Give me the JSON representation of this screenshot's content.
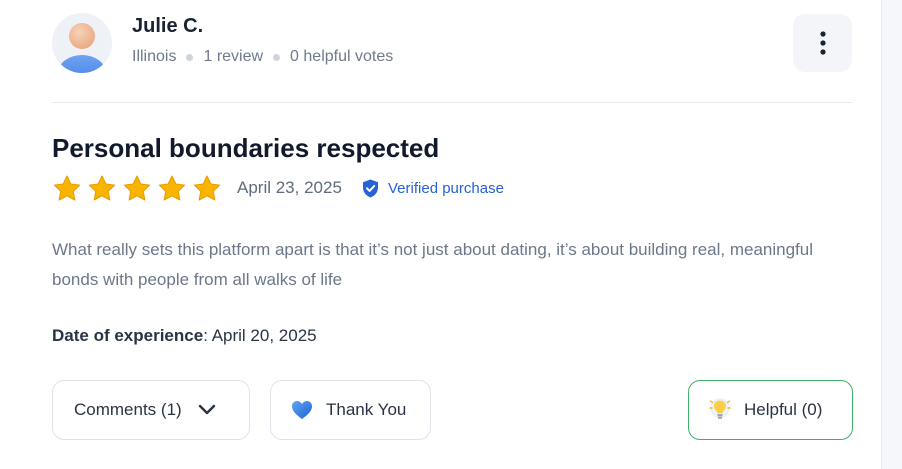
{
  "reviewer": {
    "name": "Julie C.",
    "location": "Illinois",
    "reviews": "1 review",
    "helpful_votes": "0 helpful votes"
  },
  "review": {
    "title": "Personal boundaries respected",
    "rating": 5,
    "rating_max": 5,
    "date": "April 23, 2025",
    "verified_label": "Verified purchase",
    "body": "What really sets this platform apart is that it’s not just about dating, it’s about building real, meaningful bonds with people from all walks of life",
    "experience_label": "Date of experience",
    "experience_date": "April 20, 2025"
  },
  "actions": {
    "comments_label": "Comments (1)",
    "thanks_label": "Thank You",
    "helpful_label": "Helpful (0)"
  },
  "icons": {
    "more": "more-vertical-icon",
    "verified": "shield-check-icon",
    "comments": "chevron-down-icon",
    "thanks": "blue-heart-icon",
    "helpful": "lightbulb-icon"
  },
  "colors": {
    "star": "#f7b500",
    "verified": "#2563d6",
    "helpful_border": "#3fae6a",
    "heart": "#2f7de1"
  }
}
